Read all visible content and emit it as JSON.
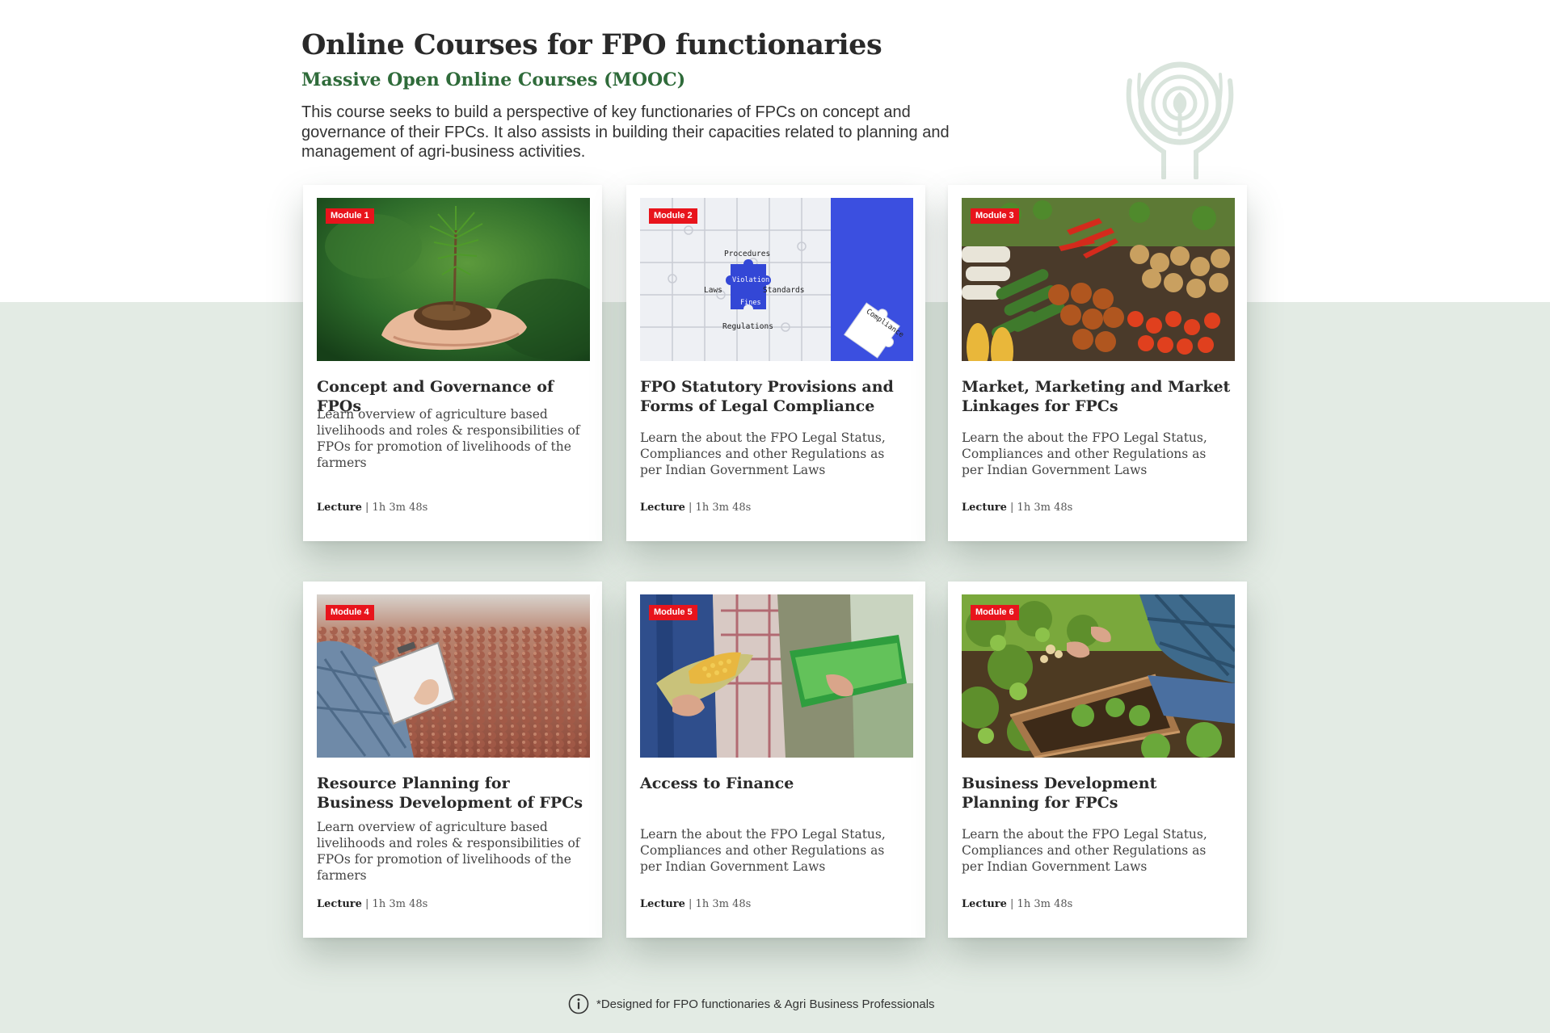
{
  "header": {
    "title": "Online Courses for FPO functionaries",
    "subtitle": "Massive Open Online Courses (MOOC)",
    "description": "This course seeks to build a perspective of key functionaries of FPCs on concept and governance of their FPCs. It also assists in building their capacities related to planning and management of agri-business activities."
  },
  "colors": {
    "accent_green": "#2f6b3a",
    "badge_red": "#e8141c",
    "lower_background": "#e3ebe4"
  },
  "courses": [
    {
      "badge": "Module 1",
      "title": "Concept and Governance of FPOs",
      "description": "Learn overview of agriculture based livelihoods and roles & responsibilities of FPOs for promotion of  livelihoods of the farmers",
      "meta_type": "Lecture",
      "meta_duration": "| 1h 3m 48s",
      "image": "sapling-in-hands"
    },
    {
      "badge": "Module 2",
      "title": "FPO Statutory Provisions and Forms of Legal Compliance",
      "description": "Learn the about the FPO Legal Status, Compliances and other Regulations as per Indian Government Laws",
      "meta_type": "Lecture",
      "meta_duration": "| 1h 3m 48s",
      "image": "compliance-puzzle",
      "image_text": {
        "procedures": "Procedures",
        "violation": "Violation",
        "laws": "Laws",
        "standards": "Standards",
        "fines": "Fines",
        "regulations": "Regulations",
        "compliance": "Compliance"
      }
    },
    {
      "badge": "Module 3",
      "title": "Market, Marketing and Market Linkages for FPCs",
      "description": "Learn the about the FPO Legal Status, Compliances and other Regulations as per Indian Government Laws",
      "meta_type": "Lecture",
      "meta_duration": "| 1h 3m 48s",
      "image": "vegetable-market"
    },
    {
      "badge": "Module 4",
      "title": "Resource Planning for Business Development of FPCs",
      "description": "Learn overview of agriculture based livelihoods and roles & responsibilities of FPOs for promotion of  livelihoods of the farmers",
      "meta_type": "Lecture",
      "meta_duration": "| 1h 3m 48s",
      "image": "clipboard-in-field"
    },
    {
      "badge": "Module 5",
      "title": "Access to Finance",
      "description": "Learn the about the FPO Legal Status, Compliances and other Regulations as per Indian Government Laws",
      "meta_type": "Lecture",
      "meta_duration": "| 1h 3m 48s",
      "image": "farmers-with-corn"
    },
    {
      "badge": "Module 6",
      "title": "Business Development Planning for FPCs",
      "description": "Learn the about the FPO Legal Status, Compliances and other Regulations as per Indian Government Laws",
      "meta_type": "Lecture",
      "meta_duration": "| 1h 3m 48s",
      "image": "garden-harvest"
    }
  ],
  "footer": {
    "note": "*Designed for FPO functionaries & Agri Business Professionals",
    "icon": "info-icon"
  }
}
